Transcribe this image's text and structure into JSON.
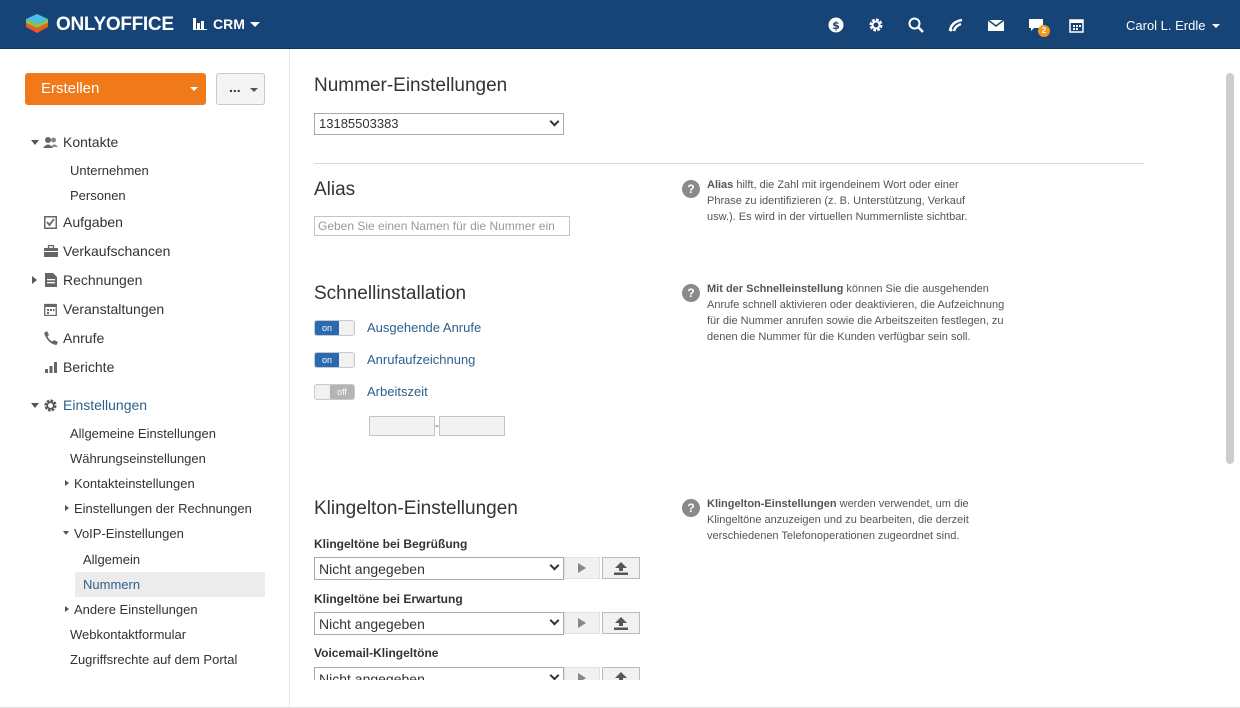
{
  "topbar": {
    "logo_text": "ONLYOFFICE",
    "module": "CRM",
    "icons": [
      "dollar-icon",
      "gear-icon",
      "search-icon",
      "feed-icon",
      "mail-icon",
      "chat-icon",
      "calendar-icon"
    ],
    "chat_badge": "2",
    "user": "Carol L. Erdle",
    "colors": {
      "bar": "#174477",
      "accent": "#f07a1a",
      "badge": "#f39a1d",
      "link": "#2d5f8b"
    }
  },
  "sidebar": {
    "create_label": "Erstellen",
    "more_label": "...",
    "items": [
      {
        "label": "Kontakte"
      },
      {
        "label": "Aufgaben"
      },
      {
        "label": "Verkaufschancen"
      },
      {
        "label": "Rechnungen"
      },
      {
        "label": "Veranstaltungen"
      },
      {
        "label": "Anrufe"
      },
      {
        "label": "Berichte"
      },
      {
        "label": "Einstellungen"
      }
    ],
    "kontakte_sub": [
      "Unternehmen",
      "Personen"
    ],
    "settings_sub": [
      "Allgemeine Einstellungen",
      "Währungseinstellungen",
      "Kontakteinstellungen",
      "Einstellungen der Rechnungen",
      "VoIP-Einstellungen",
      "Allgemein",
      "Nummern",
      "Andere Einstellungen",
      "Webkontaktformular",
      "Zugriffsrechte auf dem Portal"
    ]
  },
  "main": {
    "number_title": "Nummer-Einstellungen",
    "number_value": "13185503383",
    "alias_title": "Alias",
    "alias_placeholder": "Geben Sie einen Namen für die Nummer ein",
    "alias_help_bold": "Alias",
    "alias_help": " hilft, die Zahl mit irgendeinem Wort oder einer Phrase zu identifizieren (z. B. Unterstützung, Verkauf usw.). Es wird in der virtuellen Nummernliste sichtbar.",
    "quick_title": "Schnellinstallation",
    "toggles": [
      {
        "state": "on",
        "label": "Ausgehende Anrufe"
      },
      {
        "state": "on",
        "label": "Anrufaufzeichnung"
      },
      {
        "state": "off",
        "label": "Arbeitszeit"
      }
    ],
    "time_separator": "-",
    "quick_help_bold": "Mit der Schnelleinstellung",
    "quick_help": " können Sie die ausgehenden Anrufe schnell aktivieren oder deaktivieren, die Aufzeichnung für die Nummer anrufen sowie die Arbeitszeiten festlegen, zu denen die Nummer für die Kunden verfügbar sein soll.",
    "ring_title": "Klingelton-Einstellungen",
    "ring_help_bold": "Klingelton-Einstellungen",
    "ring_help": " werden verwendet, um die Klingeltöne anzuzeigen und zu bearbeiten, die derzeit verschiedenen Telefonoperationen zugeordnet sind.",
    "ringtones": [
      {
        "label": "Klingeltöne bei Begrüßung",
        "value": "Nicht angegeben"
      },
      {
        "label": "Klingeltöne bei Erwartung",
        "value": "Nicht angegeben"
      },
      {
        "label": "Voicemail-Klingeltöne",
        "value": "Nicht angegeben"
      }
    ]
  }
}
